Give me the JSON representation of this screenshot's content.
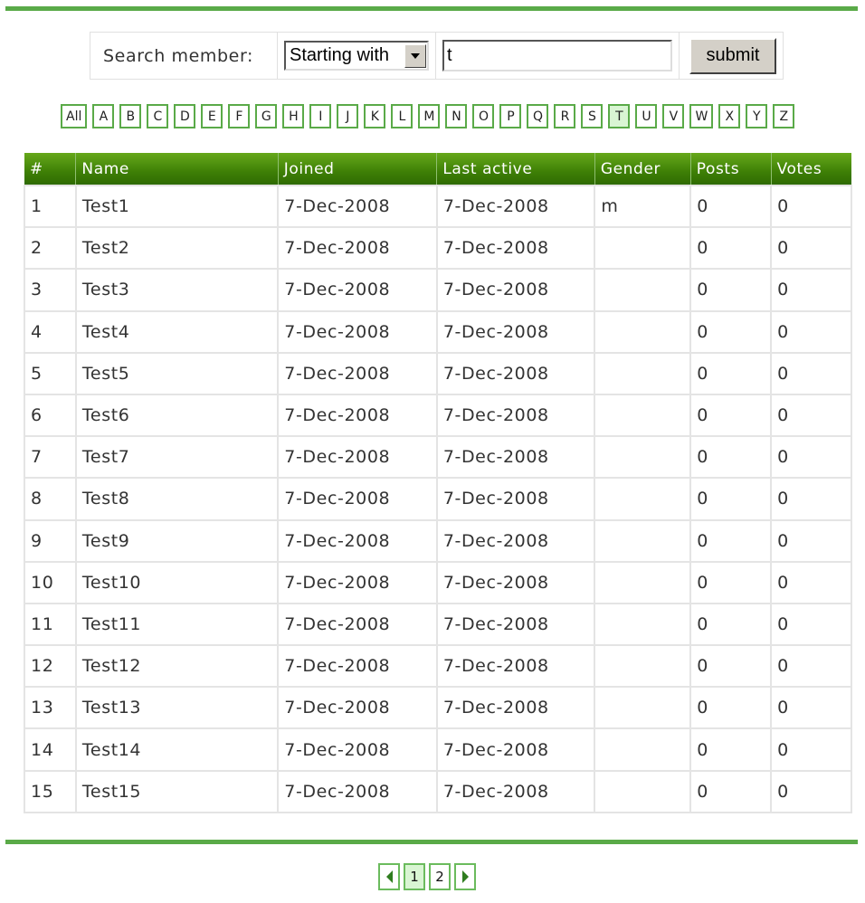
{
  "search": {
    "label": "Search member:",
    "mode_selected": "Starting with",
    "query_value": "t",
    "submit_label": "submit"
  },
  "letters": {
    "items": [
      "All",
      "A",
      "B",
      "C",
      "D",
      "E",
      "F",
      "G",
      "H",
      "I",
      "J",
      "K",
      "L",
      "M",
      "N",
      "O",
      "P",
      "Q",
      "R",
      "S",
      "T",
      "U",
      "V",
      "W",
      "X",
      "Y",
      "Z"
    ],
    "active": "T"
  },
  "table": {
    "headers": [
      "#",
      "Name",
      "Joined",
      "Last active",
      "Gender",
      "Posts",
      "Votes"
    ],
    "rows": [
      [
        "1",
        "Test1",
        "7-Dec-2008",
        "7-Dec-2008",
        "m",
        "0",
        "0"
      ],
      [
        "2",
        "Test2",
        "7-Dec-2008",
        "7-Dec-2008",
        "",
        "0",
        "0"
      ],
      [
        "3",
        "Test3",
        "7-Dec-2008",
        "7-Dec-2008",
        "",
        "0",
        "0"
      ],
      [
        "4",
        "Test4",
        "7-Dec-2008",
        "7-Dec-2008",
        "",
        "0",
        "0"
      ],
      [
        "5",
        "Test5",
        "7-Dec-2008",
        "7-Dec-2008",
        "",
        "0",
        "0"
      ],
      [
        "6",
        "Test6",
        "7-Dec-2008",
        "7-Dec-2008",
        "",
        "0",
        "0"
      ],
      [
        "7",
        "Test7",
        "7-Dec-2008",
        "7-Dec-2008",
        "",
        "0",
        "0"
      ],
      [
        "8",
        "Test8",
        "7-Dec-2008",
        "7-Dec-2008",
        "",
        "0",
        "0"
      ],
      [
        "9",
        "Test9",
        "7-Dec-2008",
        "7-Dec-2008",
        "",
        "0",
        "0"
      ],
      [
        "10",
        "Test10",
        "7-Dec-2008",
        "7-Dec-2008",
        "",
        "0",
        "0"
      ],
      [
        "11",
        "Test11",
        "7-Dec-2008",
        "7-Dec-2008",
        "",
        "0",
        "0"
      ],
      [
        "12",
        "Test12",
        "7-Dec-2008",
        "7-Dec-2008",
        "",
        "0",
        "0"
      ],
      [
        "13",
        "Test13",
        "7-Dec-2008",
        "7-Dec-2008",
        "",
        "0",
        "0"
      ],
      [
        "14",
        "Test14",
        "7-Dec-2008",
        "7-Dec-2008",
        "",
        "0",
        "0"
      ],
      [
        "15",
        "Test15",
        "7-Dec-2008",
        "7-Dec-2008",
        "",
        "0",
        "0"
      ]
    ]
  },
  "pagination": {
    "prev_icon": "triangle-left-icon",
    "pages": [
      "1",
      "2"
    ],
    "current": "1",
    "next_icon": "triangle-right-icon"
  },
  "colors": {
    "accent_green": "#5aaa48",
    "header_green": "#3e7f06",
    "active_highlight": "#d9f5d3"
  }
}
